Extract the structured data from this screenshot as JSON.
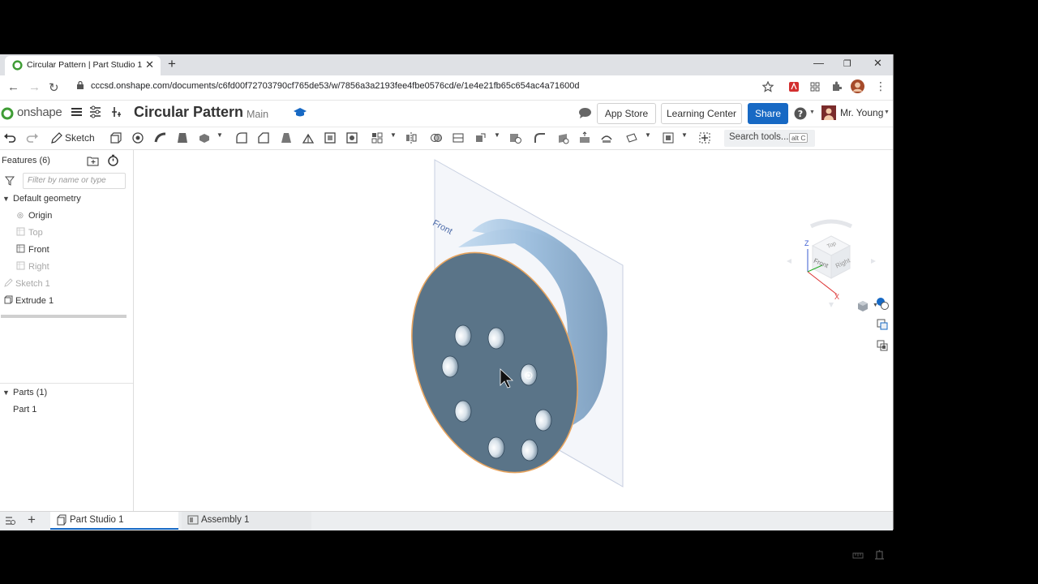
{
  "browser": {
    "tab_title": "Circular Pattern | Part Studio 1",
    "url": "cccsd.onshape.com/documents/c6fd00f72703790cf765de53/w/7856a3a2193fee4fbe0576cd/e/1e4e21fb65c654ac4a71600d"
  },
  "app": {
    "logo_text": "onshape",
    "doc_title": "Circular Pattern",
    "branch": "Main",
    "app_store_label": "App Store",
    "learning_center_label": "Learning Center",
    "share_label": "Share",
    "user_name": "Mr. Young"
  },
  "toolbar": {
    "sketch_label": "Sketch",
    "search_placeholder": "Search tools...",
    "search_shortcut": "alt C"
  },
  "feature_panel": {
    "header": "Features (6)",
    "filter_placeholder": "Filter by name or type",
    "default_geometry_label": "Default geometry",
    "items": [
      {
        "label": "Origin",
        "dimmed": false
      },
      {
        "label": "Top",
        "dimmed": true
      },
      {
        "label": "Front",
        "dimmed": false
      },
      {
        "label": "Right",
        "dimmed": true
      }
    ],
    "features": [
      {
        "label": "Sketch 1",
        "dimmed": true
      },
      {
        "label": "Extrude 1",
        "dimmed": false
      }
    ],
    "parts_header": "Parts (1)",
    "parts": [
      "Part 1"
    ]
  },
  "viewport": {
    "plane_label": "Front",
    "view_cube": {
      "top": "Top",
      "front": "Front",
      "right": "Right",
      "axis_z": "Z",
      "axis_x": "X"
    }
  },
  "bottom_tabs": [
    {
      "label": "Part Studio 1",
      "active": true
    },
    {
      "label": "Assembly 1",
      "active": false
    }
  ],
  "colors": {
    "accent": "#1769c4",
    "part_face": "#5a7488",
    "part_side": "#9fc0de",
    "selection_edge": "#e8a560"
  }
}
